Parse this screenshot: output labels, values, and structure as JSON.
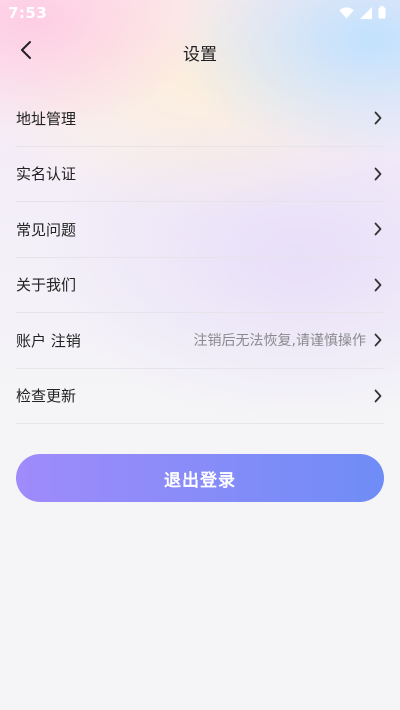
{
  "status_bar": {
    "time": "7:53",
    "icons": [
      "wifi-icon",
      "signal-icon",
      "battery-icon"
    ]
  },
  "header": {
    "title": "设置",
    "back_icon": "chevron-left-icon"
  },
  "settings": {
    "items": [
      {
        "label": "地址管理",
        "hint": ""
      },
      {
        "label": "实名认证",
        "hint": ""
      },
      {
        "label": "常见问题",
        "hint": ""
      },
      {
        "label": "关于我们",
        "hint": ""
      },
      {
        "label": "账户 注销",
        "hint": "注销后无法恢复,请谨慎操作"
      },
      {
        "label": "检查更新",
        "hint": ""
      }
    ]
  },
  "logout": {
    "label": "退出登录"
  },
  "colors": {
    "accent_start": "#a08bfb",
    "accent_end": "#6f8cf6",
    "text_primary": "#222222",
    "text_hint": "#8a8a8e",
    "divider": "#e6e4ea"
  }
}
